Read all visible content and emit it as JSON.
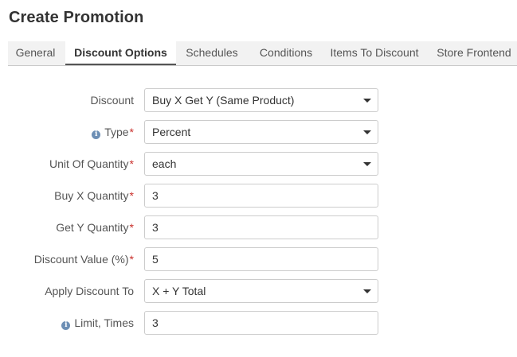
{
  "page": {
    "title": "Create Promotion"
  },
  "tabs": [
    {
      "label": "General"
    },
    {
      "label": "Discount Options",
      "active": true
    },
    {
      "label": "Schedules"
    },
    {
      "label": "Conditions"
    },
    {
      "label": "Items To Discount"
    },
    {
      "label": "Store Frontend"
    }
  ],
  "form": {
    "discount": {
      "label": "Discount",
      "value": "Buy X Get Y (Same Product)"
    },
    "type": {
      "label": "Type",
      "value": "Percent",
      "required_mark": "*"
    },
    "unit_of_quantity": {
      "label": "Unit Of Quantity",
      "value": "each",
      "required_mark": "*"
    },
    "buy_x_quantity": {
      "label": "Buy X Quantity",
      "value": "3",
      "required_mark": "*"
    },
    "get_y_quantity": {
      "label": "Get Y Quantity",
      "value": "3",
      "required_mark": "*"
    },
    "discount_value": {
      "label": "Discount Value (%)",
      "value": "5",
      "required_mark": "*"
    },
    "apply_discount_to": {
      "label": "Apply Discount To",
      "value": "X + Y Total"
    },
    "limit_times": {
      "label": "Limit, Times",
      "value": "3"
    }
  },
  "icons": {
    "info": "info-icon",
    "dropdown": "caret-down-icon"
  },
  "colors": {
    "required": "#c9302c",
    "info_icon": "#6d8fb5",
    "active_tab_underline": "#555555"
  }
}
